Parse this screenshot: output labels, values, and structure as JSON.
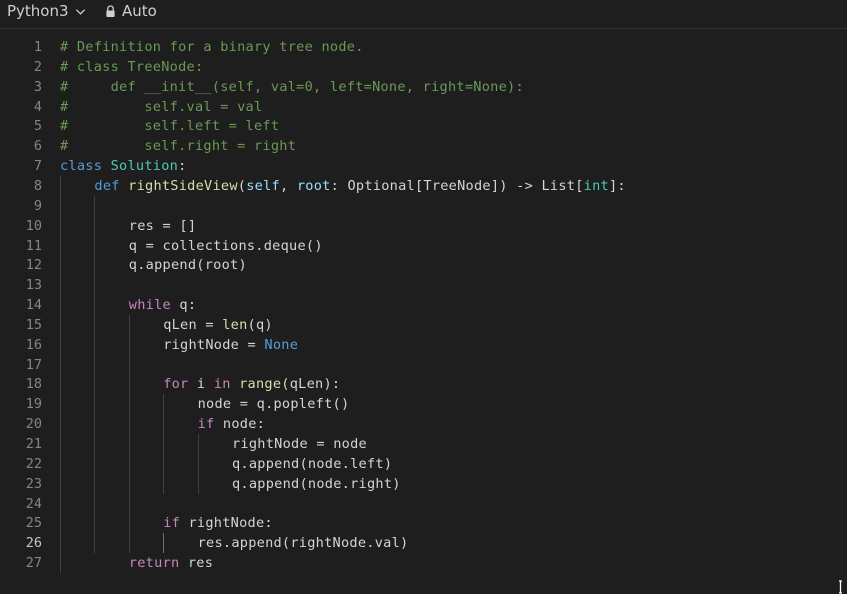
{
  "toolbar": {
    "language": "Python3",
    "mode": "Auto"
  },
  "editor": {
    "active_line": 26,
    "lines": [
      {
        "n": "1",
        "indent": 0,
        "tokens": [
          [
            "c-comment",
            "# Definition for a binary tree node."
          ]
        ]
      },
      {
        "n": "2",
        "indent": 0,
        "tokens": [
          [
            "c-comment",
            "# class TreeNode:"
          ]
        ]
      },
      {
        "n": "3",
        "indent": 0,
        "tokens": [
          [
            "c-comment",
            "#     def __init__(self, val=0, left=None, right=None):"
          ]
        ]
      },
      {
        "n": "4",
        "indent": 0,
        "tokens": [
          [
            "c-comment",
            "#         self.val = val"
          ]
        ]
      },
      {
        "n": "5",
        "indent": 0,
        "tokens": [
          [
            "c-comment",
            "#         self.left = left"
          ]
        ]
      },
      {
        "n": "6",
        "indent": 0,
        "tokens": [
          [
            "c-comment",
            "#         self.right = right"
          ]
        ]
      },
      {
        "n": "7",
        "indent": 0,
        "tokens": [
          [
            "c-def",
            "class "
          ],
          [
            "c-cls",
            "Solution"
          ],
          [
            "c-plain",
            ":"
          ]
        ]
      },
      {
        "n": "8",
        "indent": 4,
        "tokens": [
          [
            "c-def",
            "def "
          ],
          [
            "c-fn",
            "rightSideView"
          ],
          [
            "c-plain",
            "("
          ],
          [
            "c-var",
            "self"
          ],
          [
            "c-plain",
            ", "
          ],
          [
            "c-var",
            "root"
          ],
          [
            "c-plain",
            ": Optional[TreeNode]) -> List["
          ],
          [
            "c-cls",
            "int"
          ],
          [
            "c-plain",
            "]:"
          ]
        ]
      },
      {
        "n": "9",
        "indent": 0,
        "tokens": []
      },
      {
        "n": "10",
        "indent": 8,
        "tokens": [
          [
            "c-plain",
            "res = []"
          ]
        ]
      },
      {
        "n": "11",
        "indent": 8,
        "tokens": [
          [
            "c-plain",
            "q = collections.deque()"
          ]
        ]
      },
      {
        "n": "12",
        "indent": 8,
        "tokens": [
          [
            "c-plain",
            "q.append(root)"
          ]
        ]
      },
      {
        "n": "13",
        "indent": 0,
        "tokens": []
      },
      {
        "n": "14",
        "indent": 8,
        "tokens": [
          [
            "c-kw",
            "while"
          ],
          [
            "c-plain",
            " q:"
          ]
        ]
      },
      {
        "n": "15",
        "indent": 12,
        "tokens": [
          [
            "c-plain",
            "qLen = "
          ],
          [
            "c-fn",
            "len"
          ],
          [
            "c-plain",
            "(q)"
          ]
        ]
      },
      {
        "n": "16",
        "indent": 12,
        "tokens": [
          [
            "c-plain",
            "rightNode = "
          ],
          [
            "c-const",
            "None"
          ]
        ]
      },
      {
        "n": "17",
        "indent": 0,
        "tokens": []
      },
      {
        "n": "18",
        "indent": 12,
        "tokens": [
          [
            "c-kw",
            "for"
          ],
          [
            "c-plain",
            " i "
          ],
          [
            "c-kw",
            "in"
          ],
          [
            "c-plain",
            " "
          ],
          [
            "c-fn",
            "range"
          ],
          [
            "c-plain",
            "(qLen):"
          ]
        ]
      },
      {
        "n": "19",
        "indent": 16,
        "tokens": [
          [
            "c-plain",
            "node = q.popleft()"
          ]
        ]
      },
      {
        "n": "20",
        "indent": 16,
        "tokens": [
          [
            "c-kw",
            "if"
          ],
          [
            "c-plain",
            " node:"
          ]
        ]
      },
      {
        "n": "21",
        "indent": 20,
        "tokens": [
          [
            "c-plain",
            "rightNode = node"
          ]
        ]
      },
      {
        "n": "22",
        "indent": 20,
        "tokens": [
          [
            "c-plain",
            "q.append(node.left)"
          ]
        ]
      },
      {
        "n": "23",
        "indent": 20,
        "tokens": [
          [
            "c-plain",
            "q.append(node.right)"
          ]
        ]
      },
      {
        "n": "24",
        "indent": 0,
        "tokens": []
      },
      {
        "n": "25",
        "indent": 12,
        "tokens": [
          [
            "c-kw",
            "if"
          ],
          [
            "c-plain",
            " rightNode:"
          ]
        ]
      },
      {
        "n": "26",
        "indent": 16,
        "tokens": [
          [
            "c-plain",
            "res.append(rightNode.val)"
          ]
        ]
      },
      {
        "n": "27",
        "indent": 8,
        "tokens": [
          [
            "c-kw",
            "return"
          ],
          [
            "c-plain",
            " res"
          ]
        ]
      }
    ],
    "indent_guides": [
      {
        "level": 0,
        "from": 8,
        "to": 27
      },
      {
        "level": 1,
        "from": 9,
        "to": 26
      },
      {
        "level": 2,
        "from": 15,
        "to": 26
      },
      {
        "level": 3,
        "from": 19,
        "to": 23
      },
      {
        "level": 3,
        "from": 26,
        "to": 26,
        "active": true
      },
      {
        "level": 4,
        "from": 21,
        "to": 23
      }
    ]
  }
}
